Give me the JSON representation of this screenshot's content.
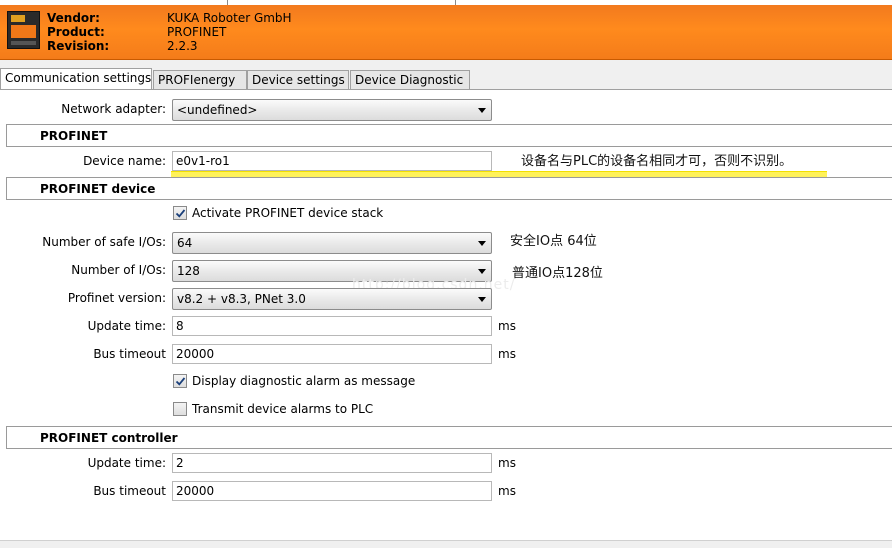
{
  "header": {
    "vendor_label": "Vendor:",
    "vendor_value": "KUKA Roboter GmbH",
    "product_label": "Product:",
    "product_value": "PROFINET",
    "revision_label": "Revision:",
    "revision_value": "2.2.3"
  },
  "tabs": [
    {
      "label": "Communication settings",
      "active": true
    },
    {
      "label": "PROFIenergy",
      "active": false
    },
    {
      "label": "Device settings",
      "active": false
    },
    {
      "label": "Device Diagnostic",
      "active": false
    }
  ],
  "network": {
    "label": "Network adapter:",
    "value": "<undefined>"
  },
  "profinet": {
    "section_title": "PROFINET",
    "device_name_label": "Device name:",
    "device_name_value": "e0v1-ro1",
    "device_name_note": "设备名与PLC的设备名相同才可，否则不识别。"
  },
  "device": {
    "section_title": "PROFINET device",
    "activate_label": "Activate PROFINET device stack",
    "activate_checked": true,
    "safe_io_label": "Number of safe I/Os:",
    "safe_io_value": "64",
    "safe_io_note": "安全IO点 64位",
    "io_label": "Number of I/Os:",
    "io_value": "128",
    "io_note": "普通IO点128位",
    "version_label": "Profinet version:",
    "version_value": "v8.2 + v8.3, PNet 3.0",
    "update_label": "Update time:",
    "update_value": "8",
    "update_unit": "ms",
    "bus_label": "Bus timeout",
    "bus_value": "20000",
    "bus_unit": "ms",
    "diag_label": "Display diagnostic alarm as message",
    "diag_checked": true,
    "transmit_label": "Transmit device alarms to PLC",
    "transmit_checked": false
  },
  "controller": {
    "section_title": "PROFINET controller",
    "update_label": "Update time:",
    "update_value": "2",
    "update_unit": "ms",
    "bus_label": "Bus timeout",
    "bus_value": "20000",
    "bus_unit": "ms"
  },
  "watermark": "http://blog.csdn.net/",
  "colors": {
    "header_orange": "#ff8a1d",
    "highlight_yellow": "#fff25a"
  }
}
